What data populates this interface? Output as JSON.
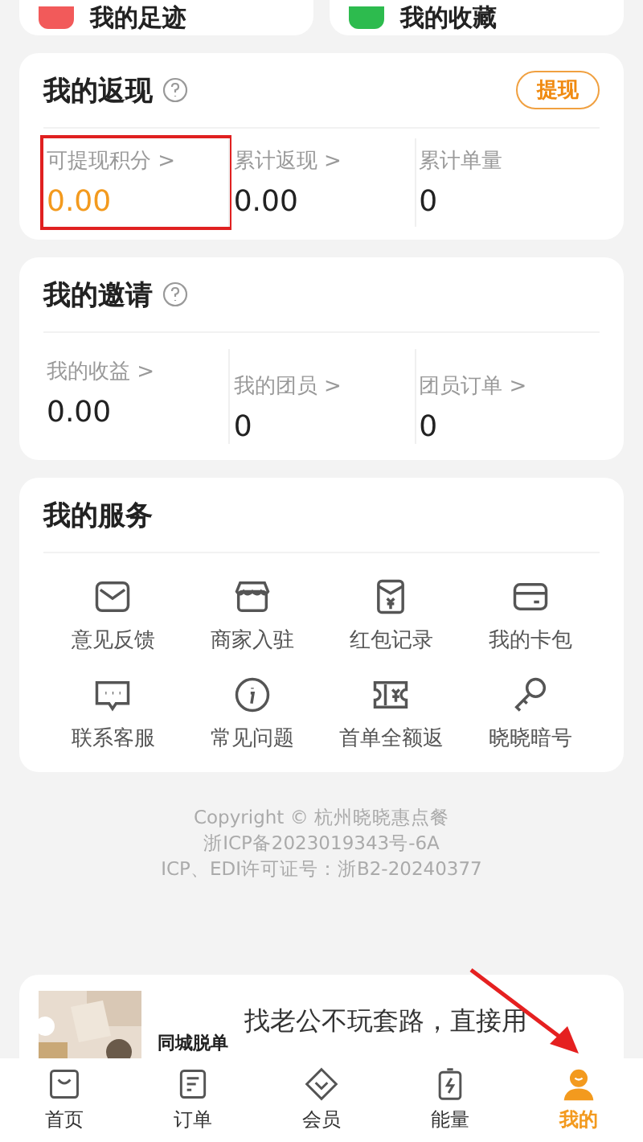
{
  "shortcuts": [
    {
      "label": "我的足迹",
      "color": "#f25a5a"
    },
    {
      "label": "我的收藏",
      "color": "#2dbb4e"
    }
  ],
  "cashback": {
    "title": "我的返现",
    "action": "提现",
    "stats": [
      {
        "label": "可提现积分 >",
        "value": "0.00",
        "highlight": true
      },
      {
        "label": "累计返现 >",
        "value": "0.00",
        "highlight": false
      },
      {
        "label": "累计单量",
        "value": "0",
        "highlight": false
      }
    ]
  },
  "invite": {
    "title": "我的邀请",
    "stats": [
      {
        "label": "我的收益 >",
        "value": "0.00"
      },
      {
        "label": "我的团员 >",
        "value": "0"
      },
      {
        "label": "团员订单 >",
        "value": "0"
      }
    ]
  },
  "services": {
    "title": "我的服务",
    "items": [
      {
        "label": "意见反馈",
        "kind": "mail"
      },
      {
        "label": "商家入驻",
        "kind": "shop"
      },
      {
        "label": "红包记录",
        "kind": "envelope"
      },
      {
        "label": "我的卡包",
        "kind": "card"
      },
      {
        "label": "联系客服",
        "kind": "chat"
      },
      {
        "label": "常见问题",
        "kind": "info"
      },
      {
        "label": "首单全额返",
        "kind": "ticket"
      },
      {
        "label": "晓晓暗号",
        "kind": "key"
      }
    ]
  },
  "copyright": [
    "Copyright © 杭州晓晓惠点餐",
    "浙ICP备2023019343号-6A",
    "ICP、EDI许可证号：浙B2-20240377"
  ],
  "ad": {
    "tag": "同城脱单",
    "title": "找老公不玩套路，直接用"
  },
  "tabbar": [
    {
      "label": "首页",
      "kind": "bag",
      "selected": false
    },
    {
      "label": "订单",
      "kind": "list",
      "selected": false
    },
    {
      "label": "会员",
      "kind": "gem",
      "selected": false
    },
    {
      "label": "能量",
      "kind": "battery",
      "selected": false
    },
    {
      "label": "我的",
      "kind": "person",
      "selected": true
    }
  ]
}
